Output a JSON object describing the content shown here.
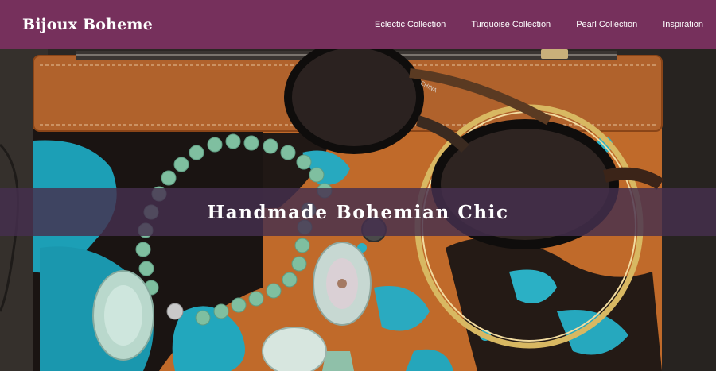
{
  "brand": {
    "name": "Bijoux Boheme"
  },
  "nav": {
    "items": [
      {
        "label": "Eclectic Collection"
      },
      {
        "label": "Turquoise Collection"
      },
      {
        "label": "Pearl Collection"
      },
      {
        "label": "Inspiration"
      }
    ]
  },
  "hero": {
    "tagline": "Handmade Bohemian Chic",
    "image_subject": "leather-cowhide-clutch-sunglasses-turquoise-necklace-gold-bangle",
    "sunglasses_print": "CHINA"
  },
  "colors": {
    "navbar": "#76305c",
    "banner": "#46304e",
    "leather": "#b0622c",
    "turquoise": "#1fa3b8",
    "bead": "#7fbfa0",
    "gold": "#d6b25e"
  }
}
